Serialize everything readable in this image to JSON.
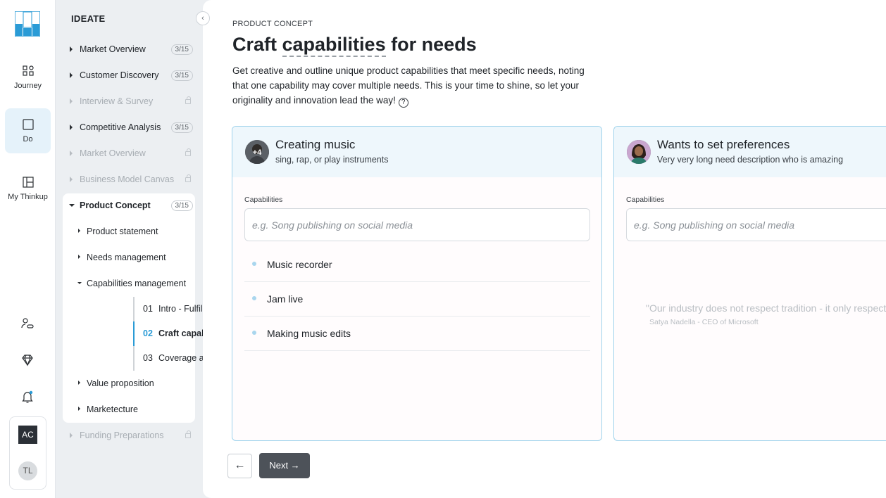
{
  "rail": {
    "items": [
      {
        "label": "Journey",
        "icon": "journey-icon"
      },
      {
        "label": "Do",
        "icon": "do-icon"
      },
      {
        "label": "My Thinkup",
        "icon": "my-thinkup-icon"
      }
    ],
    "bottom_icons": [
      "people-icon",
      "diamond-icon",
      "bell-icon"
    ],
    "users": [
      "AC",
      "TL"
    ]
  },
  "sidebar": {
    "title": "IDEATE",
    "collapse_glyph": "‹",
    "items": [
      {
        "label": "Market Overview",
        "badge": "3/15"
      },
      {
        "label": "Customer Discovery",
        "badge": "3/15"
      },
      {
        "label": "Interview & Survey",
        "locked": true
      },
      {
        "label": "Competitive Analysis",
        "badge": "3/15"
      },
      {
        "label": "Market Overview",
        "locked": true
      },
      {
        "label": "Business Model Canvas",
        "locked": true
      },
      {
        "label": "Product Concept",
        "badge": "3/15"
      },
      {
        "label": "Funding Preparations",
        "locked": true
      }
    ],
    "sub_items": [
      {
        "label": "Product statement"
      },
      {
        "label": "Needs management"
      },
      {
        "label": "Capabilities management"
      },
      {
        "label": "Value proposition"
      },
      {
        "label": "Marketecture"
      }
    ],
    "steps": [
      {
        "num": "01",
        "label": "Intro - Fulfill user needs"
      },
      {
        "num": "02",
        "label": "Craft capabilities for needs"
      },
      {
        "num": "03",
        "label": "Coverage and feasibility"
      }
    ]
  },
  "main": {
    "eyebrow": "PRODUCT CONCEPT",
    "title_pre": "Craft ",
    "title_dash": "capabilities",
    "title_post": " for needs",
    "description": "Get creative and outline unique product capabilities that meet specific needs, noting that one capability may cover multiple needs. This is your time to shine, so let your originality and innovation lead the way!",
    "help_glyph": "?",
    "cards": [
      {
        "title": "Creating music",
        "subtitle": "sing, rap, or play instruments",
        "avatar_overlay": "+4",
        "cap_label": "Capabilities",
        "placeholder": "e.g. Song publishing on social media",
        "capabilities": [
          "Music recorder",
          "Jam live",
          "Making music edits"
        ]
      },
      {
        "title": "Wants to set preferences",
        "subtitle": "Very very long need description who is amazing",
        "cap_label": "Capabilities",
        "placeholder": "e.g. Song publishing on social media",
        "quote": "\"Our industry does not respect tradition - it only respects innovation.\"",
        "quote_by": "Satya Nadella - CEO of Microsoft"
      }
    ],
    "back_glyph": "←",
    "next_label": "Next →"
  },
  "colors": {
    "accent": "#2a9bd6",
    "card_border": "#9fd3ec",
    "card_header": "#eef7fc",
    "next_button": "#4d5259"
  }
}
